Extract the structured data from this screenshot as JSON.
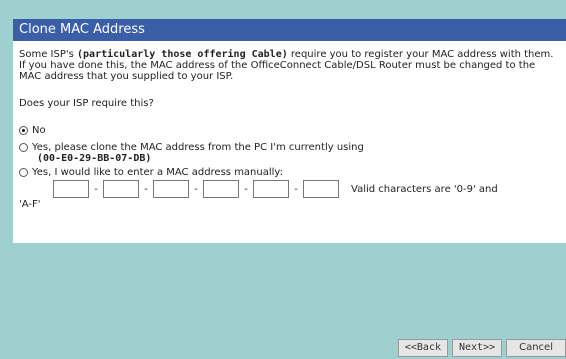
{
  "panel": {
    "title": "Clone MAC Address",
    "intro_parts": [
      "Some ISP's ",
      "(particularly those offering Cable)",
      " require you to register your MAC address with them. If you have done this, the MAC address of the OfficeConnect Cable/DSL Router must be changed to the MAC address that you supplied to your ISP."
    ],
    "question": "Does your ISP require this?",
    "options": [
      {
        "label": "No",
        "selected": true
      },
      {
        "label": "Yes, please clone the MAC address from the PC I'm currently using",
        "selected": false
      },
      {
        "label": "Yes, I would like to enter a MAC address manually:",
        "selected": false
      }
    ],
    "current_mac": "(00-E0-29-BB-07-DB)",
    "mac_fields": [
      "",
      "",
      "",
      "",
      "",
      ""
    ],
    "mac_separator": "-",
    "valid_chars_text": "Valid characters are '0-9' and",
    "valid_chars_tail": "'A-F'"
  },
  "buttons": {
    "back": "<<Back",
    "next": "Next>>",
    "cancel": "Cancel"
  }
}
